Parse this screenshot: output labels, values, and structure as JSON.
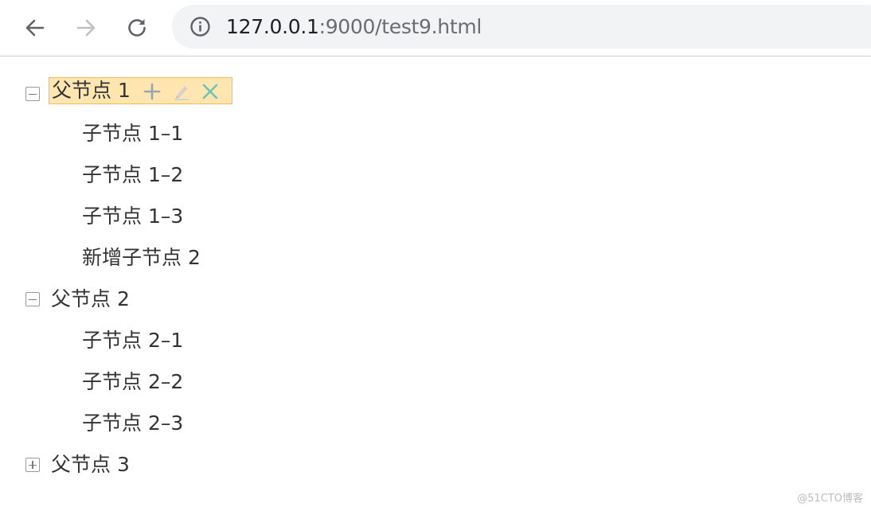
{
  "browser": {
    "url_host": "127.0.0.1",
    "url_rest": ":9000/test9.html",
    "icons": {
      "back": "arrow-left-icon",
      "forward": "arrow-right-icon",
      "reload": "reload-icon",
      "info": "info-icon"
    }
  },
  "tree": {
    "nodes": [
      {
        "label": "父节点 1",
        "state": "expanded",
        "selected": true,
        "children": [
          {
            "label": "子节点 1–1"
          },
          {
            "label": "子节点 1–2"
          },
          {
            "label": "子节点 1–3"
          },
          {
            "label": "新增子节点 2"
          }
        ]
      },
      {
        "label": "父节点 2",
        "state": "expanded",
        "children": [
          {
            "label": "子节点 2–1"
          },
          {
            "label": "子节点 2–2"
          },
          {
            "label": "子节点 2–3"
          }
        ]
      },
      {
        "label": "父节点 3",
        "state": "collapsed",
        "children": []
      }
    ],
    "actions": {
      "add": "plus-icon",
      "edit": "pencil-icon",
      "remove": "close-icon"
    },
    "colors": {
      "selected_bg": "#ffe6b0",
      "selected_border": "#ffb951",
      "edit_icon": "#c6c2bb",
      "remove_icon": "#6ec3b1",
      "add_icon": "#9aa5b4"
    }
  },
  "watermark": "@51CTO博客"
}
